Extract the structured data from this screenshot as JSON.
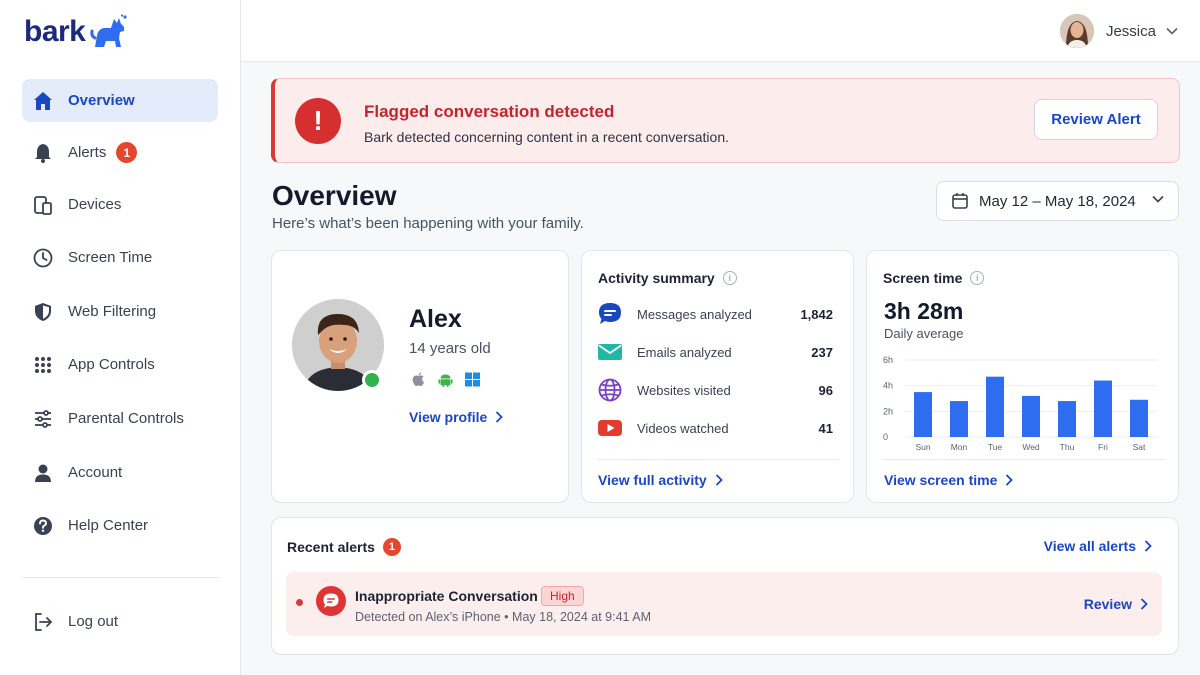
{
  "brand": {
    "name": "bark",
    "color": "#1b2a7a",
    "accent": "#2f6df0"
  },
  "sidebar": {
    "items": [
      {
        "label": "Overview",
        "icon": "home-icon",
        "active": true
      },
      {
        "label": "Alerts",
        "icon": "bell-icon",
        "badge": "1"
      },
      {
        "label": "Devices",
        "icon": "devices-icon"
      },
      {
        "label": "Screen Time",
        "icon": "clock-icon"
      },
      {
        "label": "Web Filtering",
        "icon": "shield-icon"
      },
      {
        "label": "App Controls",
        "icon": "grid-icon"
      },
      {
        "label": "Parental Controls",
        "icon": "sliders-icon"
      },
      {
        "label": "Account",
        "icon": "person-icon"
      },
      {
        "label": "Help Center",
        "icon": "help-icon"
      }
    ],
    "logout": {
      "label": "Log out",
      "icon": "logout-icon"
    }
  },
  "header": {
    "user_name": "Jessica"
  },
  "banner": {
    "title": "Flagged conversation detected",
    "subtitle": "Bark detected concerning content in a recent conversation.",
    "button": "Review Alert",
    "color": "#d62f2f"
  },
  "main": {
    "title": "Overview",
    "subtitle": "Here’s what’s been happening with your family.",
    "date_range": "May 12 – May 18, 2024"
  },
  "profile": {
    "name": "Alex",
    "age": "14 years old",
    "platforms": [
      "apple-icon",
      "android-icon",
      "windows-icon"
    ],
    "link": "View profile"
  },
  "activity": {
    "title": "Activity summary",
    "rows": [
      {
        "label": "Messages analyzed",
        "value": "1,842",
        "icon": "chat-icon"
      },
      {
        "label": "Emails analyzed",
        "value": "237",
        "icon": "email-icon"
      },
      {
        "label": "Websites visited",
        "value": "96",
        "icon": "globe-icon"
      },
      {
        "label": "Videos watched",
        "value": "41",
        "icon": "video-icon"
      }
    ],
    "link": "View full activity"
  },
  "screen_time": {
    "title": "Screen time",
    "total": "3h 28m",
    "caption": "Daily average",
    "link": "View screen time"
  },
  "chart_data": {
    "type": "bar",
    "categories": [
      "Sun",
      "Mon",
      "Tue",
      "Wed",
      "Thu",
      "Fri",
      "Sat"
    ],
    "values": [
      3.5,
      2.8,
      4.7,
      3.2,
      2.8,
      4.4,
      2.9
    ],
    "yticks": [
      "0",
      "2h",
      "4h",
      "6h"
    ],
    "ylim": [
      0,
      6
    ],
    "unit": "hours",
    "bar_color": "#2f6df0",
    "grid": true
  },
  "recent_alerts": {
    "title": "Recent alerts",
    "badge": "1",
    "view_all": "View all alerts",
    "items": [
      {
        "title": "Inappropriate Conversation",
        "severity": "High",
        "meta": "Detected on Alex’s iPhone • May 18, 2024 at 9:41 AM",
        "action": "Review"
      }
    ]
  }
}
